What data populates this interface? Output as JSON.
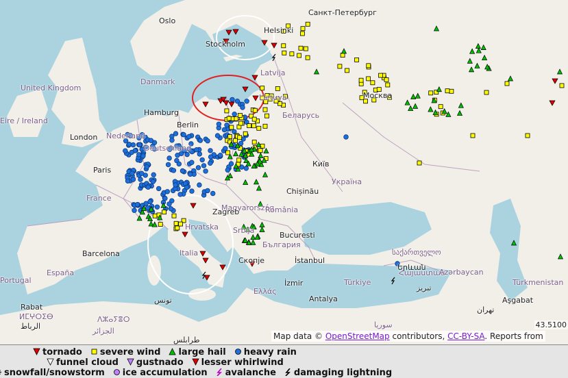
{
  "labels": [
    {
      "text": "Oslo",
      "kind": "city"
    },
    {
      "text": "Stockholm",
      "kind": "city"
    },
    {
      "text": "Helsinki",
      "kind": "city"
    },
    {
      "text": "Санкт-Петербург",
      "kind": "city"
    },
    {
      "text": "United Kingdom",
      "kind": "country"
    },
    {
      "text": "Danmark",
      "kind": "country"
    },
    {
      "text": "Latvija",
      "kind": "country"
    },
    {
      "text": "Lietuva",
      "kind": "country"
    },
    {
      "text": "Москва",
      "kind": "city"
    },
    {
      "text": "Eire / Ireland",
      "kind": "country"
    },
    {
      "text": "Hamburg",
      "kind": "city"
    },
    {
      "text": "Беларусь",
      "kind": "country"
    },
    {
      "text": "Nederland",
      "kind": "country"
    },
    {
      "text": "London",
      "kind": "city"
    },
    {
      "text": "Berlin",
      "kind": "city"
    },
    {
      "text": "Deutschland",
      "kind": "country"
    },
    {
      "text": "Київ",
      "kind": "city"
    },
    {
      "text": "Paris",
      "kind": "city"
    },
    {
      "text": "Україна",
      "kind": "country"
    },
    {
      "text": "France",
      "kind": "country"
    },
    {
      "text": "Chișinău",
      "kind": "city"
    },
    {
      "text": "Magyarország",
      "kind": "country"
    },
    {
      "text": "Zagreb",
      "kind": "city"
    },
    {
      "text": "România",
      "kind": "country"
    },
    {
      "text": "Hrvatska",
      "kind": "country"
    },
    {
      "text": "Srbija",
      "kind": "country"
    },
    {
      "text": "Bucuresti",
      "kind": "city"
    },
    {
      "text": "България",
      "kind": "country"
    },
    {
      "text": "Barcelona",
      "kind": "city"
    },
    {
      "text": "Italia",
      "kind": "country"
    },
    {
      "text": "Скопје",
      "kind": "city"
    },
    {
      "text": "İstanbul",
      "kind": "city"
    },
    {
      "text": "საქართველო",
      "kind": "country"
    },
    {
      "text": "Portugal",
      "kind": "country"
    },
    {
      "text": "España",
      "kind": "country"
    },
    {
      "text": "Ελλάς",
      "kind": "country"
    },
    {
      "text": "İzmir",
      "kind": "city"
    },
    {
      "text": "Türkiye",
      "kind": "country"
    },
    {
      "text": "Հայաստան",
      "kind": "country"
    },
    {
      "text": "Azərbaycan",
      "kind": "country"
    },
    {
      "text": "Türkmenistan",
      "kind": "country"
    },
    {
      "text": "Rabat",
      "kind": "city"
    },
    {
      "text": "ⵍⵎⵖⵔⵉⴱ",
      "kind": "country"
    },
    {
      "text": "تونس",
      "kind": "city"
    },
    {
      "text": "ⴷⵣⴰⵢⴻⵔ",
      "kind": "country"
    },
    {
      "text": "Antalya",
      "kind": "city"
    },
    {
      "text": "تبریز",
      "kind": "city"
    },
    {
      "text": "Aşgabat",
      "kind": "city"
    },
    {
      "text": "طرابلس",
      "kind": "city"
    },
    {
      "text": "سوريا",
      "kind": "country"
    },
    {
      "text": "تهران",
      "kind": "city"
    },
    {
      "text": "Երևան",
      "kind": "city"
    },
    {
      "text": "الرباط",
      "kind": "city"
    },
    {
      "text": "الجزائر",
      "kind": "country"
    }
  ],
  "coordinate_readout": "43.5100",
  "attribution": {
    "prefix": "Map data ©",
    "osm_link": "OpenStreetMap",
    "middle": "contributors,",
    "license_link": "CC-BY-SA",
    "suffix": ". Reports from"
  },
  "legend": {
    "row1": [
      {
        "icon": "tornado-icon",
        "label": "tornado",
        "color": "#e00000"
      },
      {
        "icon": "severe-wind-icon",
        "label": "severe wind",
        "color": "#ffff00"
      },
      {
        "icon": "large-hail-icon",
        "label": "large hail",
        "color": "#00c000"
      },
      {
        "icon": "heavy-rain-icon",
        "label": "heavy rain",
        "color": "#1e6fd9"
      }
    ],
    "row2": [
      {
        "icon": "funnel-cloud-icon",
        "label": "funnel cloud",
        "color": "#ffffff"
      },
      {
        "icon": "gustnado-icon",
        "label": "gustnado",
        "color": "#c080ff"
      },
      {
        "icon": "lesser-whirlwind-icon",
        "label": "lesser whirlwind",
        "color": "#e00000"
      }
    ],
    "row3": [
      {
        "icon": "snowfall-icon",
        "label": "snowfall/snowstorm",
        "color": "#ffffff"
      },
      {
        "icon": "ice-accumulation-icon",
        "label": "ice accumulation",
        "color": "#c080ff"
      },
      {
        "icon": "avalanche-icon",
        "label": "avalanche",
        "color": "#c000c0"
      },
      {
        "icon": "damaging-lightning-icon",
        "label": "damaging lightning",
        "color": "#000000"
      }
    ]
  },
  "highlight_colors": {
    "white": "#ffffff",
    "red": "#e02020"
  },
  "colors": {
    "land": "#f2efe9",
    "sea": "#aad3df",
    "border": "#b08fb8"
  }
}
